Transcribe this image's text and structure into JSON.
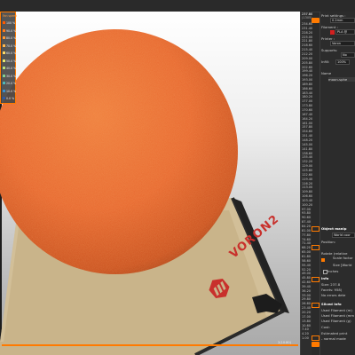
{
  "viewport": {
    "collapse_glyph": "»",
    "bed_brand": "VORON2",
    "bottom_readout": "2(10.80)"
  },
  "legend": {
    "title": "Fan speed",
    "items": [
      {
        "label": "100 %",
        "color": "#ff5a00"
      },
      {
        "label": "90.0 %",
        "color": "#ff7a1a"
      },
      {
        "label": "80.0 %",
        "color": "#ff9933"
      },
      {
        "label": "70.0 %",
        "color": "#ffb84d"
      },
      {
        "label": "60.0 %",
        "color": "#ffd966"
      },
      {
        "label": "50.0 %",
        "color": "#e8e86e"
      },
      {
        "label": "40.0 %",
        "color": "#b8e07a"
      },
      {
        "label": "30.0 %",
        "color": "#80d090"
      },
      {
        "label": "20.0 %",
        "color": "#4fb8b8"
      },
      {
        "label": "10.0 %",
        "color": "#3a90d0"
      },
      {
        "label": "0.0 %",
        "color": "#2d5aa8"
      }
    ]
  },
  "layers": {
    "top": "237.80",
    "top_sub": "(1305)",
    "ticks": [
      "234.60",
      "231.40",
      "228.20",
      "225.00",
      "221.80",
      "218.60",
      "215.40",
      "212.20",
      "209.00",
      "205.80",
      "202.60",
      "199.40",
      "196.20",
      "193.00",
      "189.80",
      "186.60",
      "183.40",
      "180.20",
      "177.00",
      "173.80",
      "170.60",
      "167.40",
      "164.20",
      "161.00",
      "157.80",
      "154.60",
      "151.40",
      "148.20",
      "145.00",
      "141.80",
      "138.60",
      "135.40",
      "132.20",
      "129.00",
      "125.80",
      "122.60",
      "119.40",
      "116.20",
      "113.00",
      "109.80",
      "106.60",
      "103.40",
      "100.20",
      "97.00",
      "93.80",
      "90.60",
      "87.40",
      "84.20",
      "81.00",
      "77.80",
      "74.60",
      "71.40",
      "68.20",
      "65.00",
      "61.80",
      "58.60",
      "55.40",
      "52.20",
      "49.00",
      "45.80",
      "42.60",
      "39.40",
      "36.20",
      "33.00",
      "29.80",
      "26.60",
      "23.40",
      "20.20",
      "17.00",
      "13.80",
      "10.60",
      "7.40",
      "4.20",
      "1.00"
    ]
  },
  "sidebar": {
    "print_settings_label": "Print settings :",
    "print_settings_value": "0.2mm",
    "filament_label": "Filament :",
    "filament_value": "PLA @",
    "printer_label": "Printer :",
    "printer_value": "Voron",
    "supports_label": "Supports:",
    "supports_value": "No",
    "infill_label": "Infill:",
    "infill_value": "100%",
    "name_header": "Name",
    "object_name": "moon-sphe",
    "object_manip_header": "Object manip",
    "world_coords": "World coor",
    "position_label": "Position:",
    "rotate_label": "Rotate (relative",
    "scale_factors_label": "Scale factor",
    "size_label": "Size [World",
    "inches_label": "Inches",
    "info_header": "Info",
    "info_size": "Size:   237.8",
    "info_facets": "Facets:  958(",
    "info_errors": "No errors dete",
    "sliced_header": "Sliced Info",
    "used_filament_m": "Used Filament (m)",
    "used_filament_mm3": "Used Filament (mm",
    "used_filament_g": "Used Filament (g)",
    "cost": "Cost:",
    "estimated_time": "Estimated print",
    "normal_mode": "- normal mode"
  }
}
